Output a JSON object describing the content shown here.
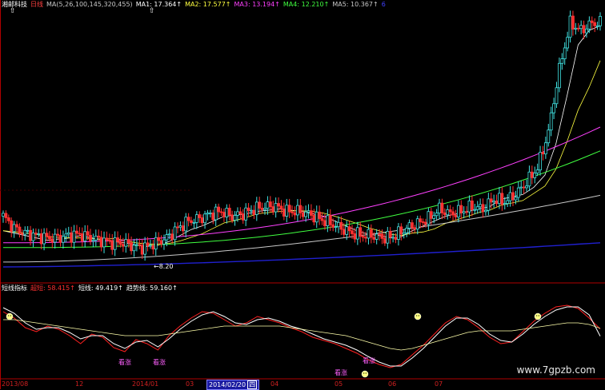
{
  "header": {
    "stock_name": "湘邮科技",
    "period": "日线",
    "ma_params": "MA(5,26,100,145,320,455)",
    "ma_values": [
      {
        "label": "MA1: 17.364",
        "color": "#ffffff"
      },
      {
        "label": "MA2: 17.577",
        "color": "#ffff40"
      },
      {
        "label": "MA3: 13.194",
        "color": "#ff40ff"
      },
      {
        "label": "MA4: 12.210",
        "color": "#40ff40"
      },
      {
        "label": "MA5: 10.367",
        "color": "#c8c8c8"
      },
      {
        "label": "6",
        "color": "#4040ff"
      }
    ],
    "up_arrow": "↑"
  },
  "indicator_header": {
    "name": "短线指标",
    "items": [
      {
        "label": "超短: 58.415↑",
        "color": "#ff3030"
      },
      {
        "label": "短线: 49.419↑",
        "color": "#ffffff"
      },
      {
        "label": "趋势线: 59.160↑",
        "color": "#ffffff"
      }
    ]
  },
  "price_annotation": "8.20",
  "buy_label": "看涨",
  "x_axis": {
    "ticks": [
      "2013/08",
      "12",
      "2014/01",
      "03",
      "04",
      "05",
      "06",
      "07"
    ],
    "cursor_date": "2014/02/20",
    "cursor_day": "四"
  },
  "watermark": "www.7gpzb.com",
  "colors": {
    "background": "#000000",
    "up": "#40e0e0",
    "down": "#ff3030",
    "axis": "#b00000",
    "ma1": "#ffffff",
    "ma2": "#ffff40",
    "ma3": "#ff40ff",
    "ma4": "#40ff40",
    "ma5": "#c8c8c8",
    "ma6": "#2020d0"
  },
  "chart_data": [
    {
      "type": "candlestick",
      "title": "湘邮科技 日线",
      "series": [
        {
          "name": "MA1",
          "values": [
            8.9,
            8.8,
            8.7,
            8.6,
            8.5,
            8.55,
            8.6,
            8.7,
            8.6,
            8.5,
            8.45,
            8.4,
            8.3,
            8.25,
            8.3,
            8.45,
            8.7,
            8.95,
            9.1,
            9.3,
            9.5,
            9.55,
            9.6,
            9.7,
            9.75,
            9.8,
            9.75,
            9.7,
            9.6,
            9.5,
            9.3,
            9.1,
            8.9,
            8.75,
            8.7,
            8.6,
            8.65,
            8.9,
            9.1,
            9.3,
            9.5,
            9.6,
            9.7,
            9.8,
            9.9,
            10.2,
            10.3,
            10.4,
            10.7,
            11.2,
            12.5,
            14.5,
            16.6,
            17.2,
            17.4
          ]
        }
      ],
      "ohlc_trend": [
        9.5,
        9.0,
        8.8,
        8.7,
        8.6,
        8.6,
        8.7,
        8.75,
        8.6,
        8.5,
        8.4,
        8.4,
        8.25,
        8.2,
        8.4,
        8.6,
        9.0,
        9.3,
        9.4,
        9.6,
        9.7,
        9.5,
        9.6,
        9.8,
        9.9,
        9.9,
        9.7,
        9.7,
        9.6,
        9.4,
        9.2,
        9.0,
        8.8,
        8.7,
        8.7,
        8.6,
        8.7,
        9.0,
        9.2,
        9.4,
        9.8,
        9.6,
        9.7,
        9.9,
        9.8,
        10.2,
        10.1,
        10.4,
        10.9,
        11.5,
        13.0,
        15.6,
        17.5,
        17.2,
        17.5
      ],
      "ma_levels_end": {
        "MA1": 17.364,
        "MA2": 17.577,
        "MA3": 13.194,
        "MA4": 12.21,
        "MA5": 10.367
      },
      "low_annotation": 8.2
    },
    {
      "type": "line",
      "title": "短线指标",
      "series": [
        {
          "name": "超短",
          "values": [
            80,
            72,
            60,
            55,
            62,
            58,
            50,
            40,
            52,
            48,
            35,
            30,
            45,
            40,
            32,
            50,
            62,
            72,
            80,
            78,
            70,
            62,
            66,
            74,
            70,
            66,
            60,
            55,
            48,
            44,
            40,
            34,
            28,
            20,
            14,
            10,
            14,
            26,
            38,
            52,
            66,
            74,
            70,
            60,
            48,
            40,
            42,
            55,
            68,
            78,
            86,
            88,
            84,
            72,
            58.415
          ]
        },
        {
          "name": "短线",
          "values": [
            85,
            78,
            66,
            58,
            60,
            60,
            54,
            46,
            50,
            50,
            40,
            34,
            42,
            44,
            36,
            46,
            58,
            68,
            76,
            80,
            74,
            66,
            64,
            70,
            72,
            68,
            62,
            58,
            52,
            46,
            42,
            38,
            32,
            24,
            17,
            12,
            12,
            22,
            34,
            48,
            62,
            72,
            72,
            64,
            52,
            44,
            42,
            52,
            64,
            74,
            82,
            86,
            86,
            76,
            49.419
          ]
        },
        {
          "name": "趋势线",
          "values": [
            70,
            70,
            68,
            66,
            64,
            62,
            60,
            58,
            56,
            54,
            52,
            50,
            50,
            50,
            50,
            52,
            54,
            56,
            58,
            60,
            62,
            62,
            62,
            62,
            62,
            62,
            60,
            58,
            56,
            54,
            52,
            50,
            46,
            42,
            38,
            34,
            32,
            34,
            38,
            42,
            46,
            50,
            54,
            56,
            56,
            56,
            56,
            58,
            60,
            62,
            64,
            66,
            66,
            64,
            59.16
          ]
        }
      ]
    }
  ]
}
